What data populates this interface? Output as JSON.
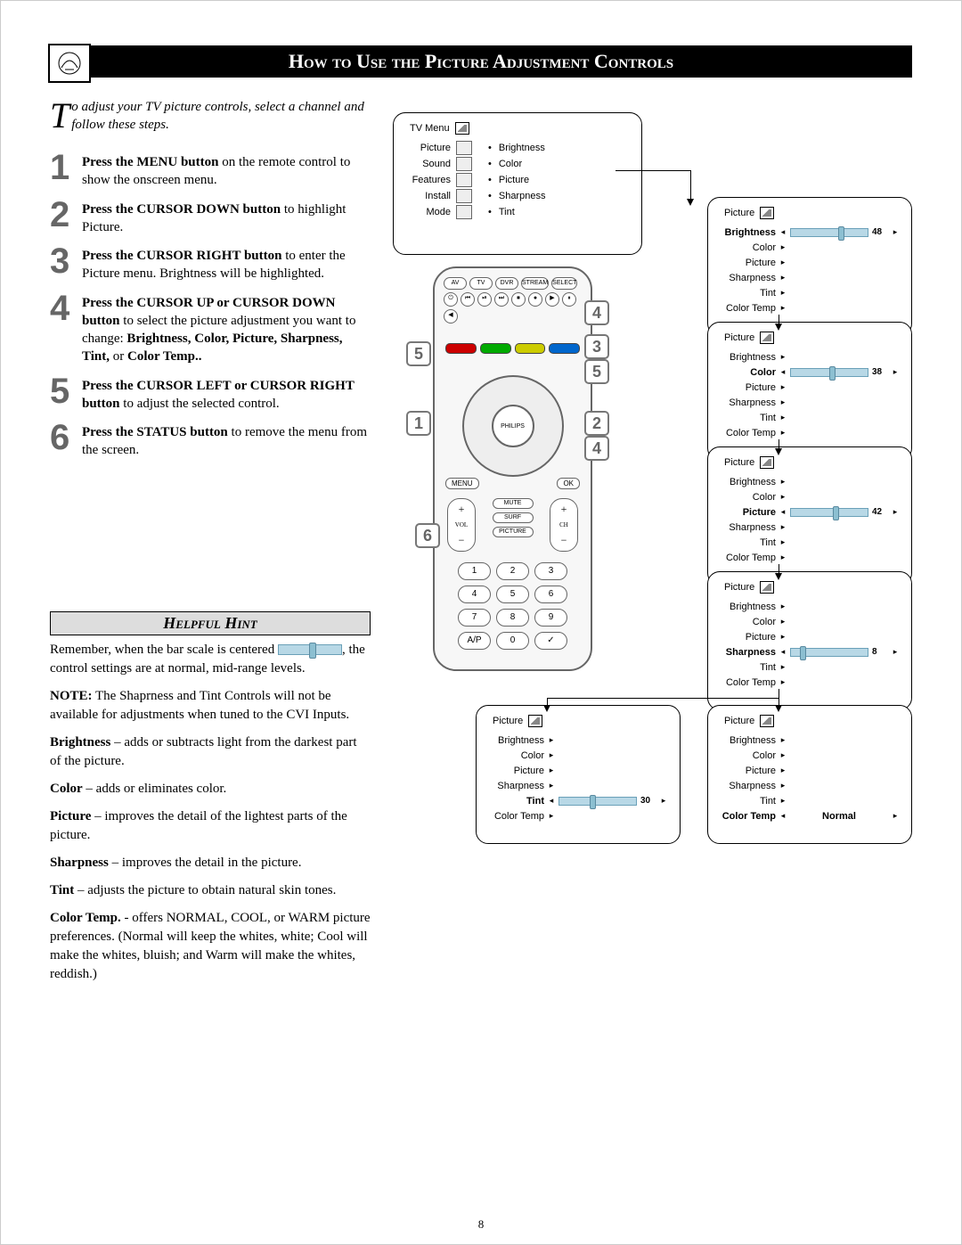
{
  "title": "How to Use the Picture Adjustment Controls",
  "intro_dropcap": "T",
  "intro": "o adjust your TV picture controls, select a channel and follow these steps.",
  "steps": [
    {
      "n": "1",
      "bold": "Press the MENU button",
      "rest": " on the remote control to show the onscreen menu."
    },
    {
      "n": "2",
      "bold": "Press the CURSOR DOWN button",
      "rest": " to highlight Picture."
    },
    {
      "n": "3",
      "bold": "Press the CURSOR RIGHT button",
      "rest": " to enter the Picture menu. Brightness will be highlighted."
    },
    {
      "n": "4",
      "bold": "Press the CURSOR UP or CURSOR DOWN button",
      "rest": " to select the picture adjustment you want to change: ",
      "bold2": "Brightness, Color, Picture, Sharpness, Tint,",
      "rest2": " or ",
      "bold3": "Color Temp.."
    },
    {
      "n": "5",
      "bold": "Press the CURSOR LEFT or CURSOR RIGHT button",
      "rest": " to adjust the selected control."
    },
    {
      "n": "6",
      "bold": "Press the STATUS button",
      "rest": " to remove the menu from the screen."
    }
  ],
  "hint_title": "Helpful Hint",
  "hint": {
    "p1a": "Remember, when the bar scale is centered ",
    "p1b": ", the control settings are at normal, mid-range levels.",
    "note_label": "NOTE:",
    "note_text": " The Shaprness and Tint Controls will not be available for adjustments when tuned to the CVI  Inputs.",
    "items": [
      {
        "term": "Brightness",
        "def": " – adds or subtracts light from the darkest part of the picture."
      },
      {
        "term": "Color",
        "def": " – adds or eliminates color."
      },
      {
        "term": "Picture",
        "def": " – improves the detail of the lightest parts of the picture."
      },
      {
        "term": "Sharpness",
        "def": " – improves the detail in the picture."
      },
      {
        "term": "Tint",
        "def": " – adjusts the picture to obtain natural skin tones."
      },
      {
        "term": "Color Temp.",
        "def": " - offers NORMAL, COOL, or WARM picture preferences. (Normal will keep the whites, white; Cool will make the whites, bluish; and Warm will make the whites, reddish.)"
      }
    ]
  },
  "tvmenu": {
    "title": "TV Menu",
    "left": [
      "Picture",
      "Sound",
      "Features",
      "Install",
      "Mode"
    ],
    "right": [
      "Brightness",
      "Color",
      "Picture",
      "Sharpness",
      "Tint"
    ]
  },
  "picture_panel_title": "Picture",
  "pic_rows": [
    "Brightness",
    "Color",
    "Picture",
    "Sharpness",
    "Tint",
    "Color Temp"
  ],
  "panels": [
    {
      "sel": "Brightness",
      "val": "48",
      "knob": 62
    },
    {
      "sel": "Color",
      "val": "38",
      "knob": 50
    },
    {
      "sel": "Picture",
      "val": "42",
      "knob": 55
    },
    {
      "sel": "Sharpness",
      "val": "8",
      "knob": 12
    },
    {
      "sel": "Tint",
      "val": "30",
      "knob": 40
    },
    {
      "sel": "Color Temp",
      "val": "Normal",
      "knob": 50
    }
  ],
  "remote": {
    "brand": "PHILIPS",
    "menu": "MENU",
    "ok": "OK",
    "vol": "VOL",
    "ch": "CH",
    "mute": "MUTE",
    "surf": "SURF",
    "picture": "PICTURE"
  },
  "callouts": [
    "1",
    "2",
    "3",
    "4",
    "5",
    "6"
  ],
  "page_number": "8"
}
